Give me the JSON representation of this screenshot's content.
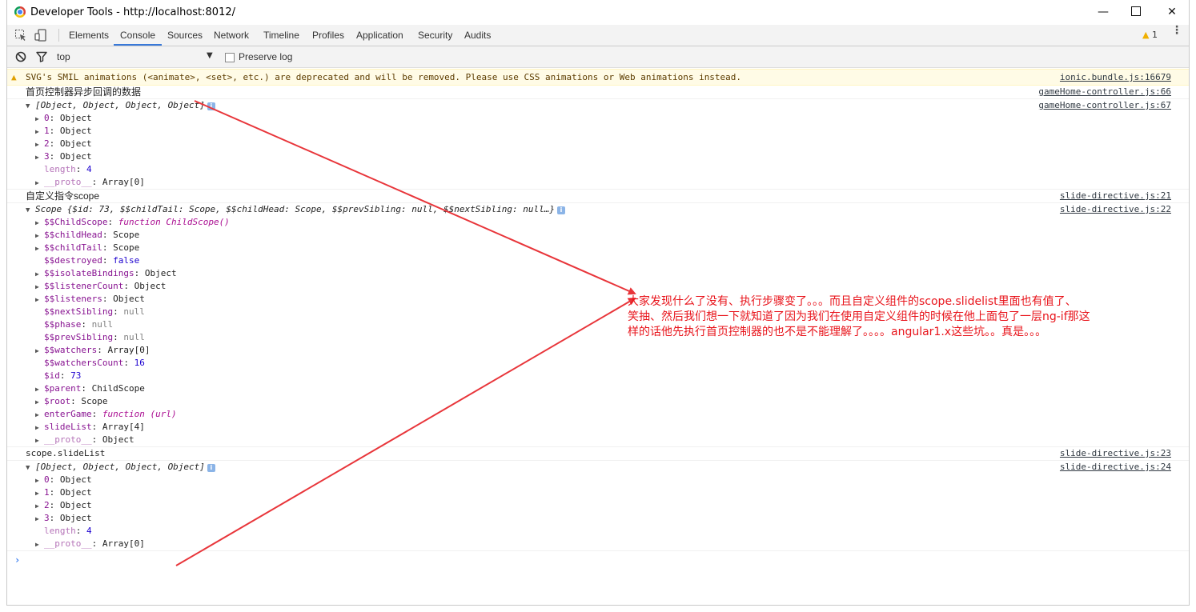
{
  "window": {
    "title": "Developer Tools - http://localhost:8012/",
    "minimize_glyph": "—",
    "close_glyph": "✕"
  },
  "tabs": [
    {
      "label": "Elements"
    },
    {
      "label": "Console",
      "active": true
    },
    {
      "label": "Sources"
    },
    {
      "label": "Network"
    },
    {
      "label": "Timeline"
    },
    {
      "label": "Profiles"
    },
    {
      "label": "Application"
    },
    {
      "label": "Security"
    },
    {
      "label": "Audits"
    }
  ],
  "warnings_count": "1",
  "filterbar": {
    "context": "top",
    "preserve_log_label": "Preserve log",
    "preserve_log_checked": false
  },
  "console": {
    "warning": {
      "text": "SVG's SMIL animations (<animate>, <set>, etc.) are deprecated and will be removed. Please use CSS animations or Web animations instead.",
      "source": "ionic.bundle.js:16679"
    },
    "log1": {
      "text": "首页控制器异步回调的数据",
      "source": "gameHome-controller.js:66"
    },
    "array1": {
      "summary": "[Object, Object, Object, Object]",
      "source": "gameHome-controller.js:67",
      "items": [
        {
          "key": "0",
          "value": "Object"
        },
        {
          "key": "1",
          "value": "Object"
        },
        {
          "key": "2",
          "value": "Object"
        },
        {
          "key": "3",
          "value": "Object"
        }
      ],
      "length_key": "length",
      "length_value": "4",
      "proto_key": "__proto__",
      "proto_value": "Array[0]"
    },
    "log2": {
      "text": "自定义指令scope",
      "source": "slide-directive.js:21"
    },
    "scope": {
      "summary_prefix": "Scope ",
      "summary": "{$id: 73, $$childTail: Scope, $$childHead: Scope, $$prevSibling: null, $$nextSibling: null…}",
      "source": "slide-directive.js:22",
      "props": [
        {
          "key": "$$ChildScope",
          "value": "function ChildScope()",
          "expandable": true,
          "kind": "fn"
        },
        {
          "key": "$$childHead",
          "value": "Scope",
          "expandable": true,
          "kind": "obj"
        },
        {
          "key": "$$childTail",
          "value": "Scope",
          "expandable": true,
          "kind": "obj"
        },
        {
          "key": "$$destroyed",
          "value": "false",
          "expandable": false,
          "kind": "bool"
        },
        {
          "key": "$$isolateBindings",
          "value": "Object",
          "expandable": true,
          "kind": "obj"
        },
        {
          "key": "$$listenerCount",
          "value": "Object",
          "expandable": true,
          "kind": "obj"
        },
        {
          "key": "$$listeners",
          "value": "Object",
          "expandable": true,
          "kind": "obj"
        },
        {
          "key": "$$nextSibling",
          "value": "null",
          "expandable": false,
          "kind": "null"
        },
        {
          "key": "$$phase",
          "value": "null",
          "expandable": false,
          "kind": "null"
        },
        {
          "key": "$$prevSibling",
          "value": "null",
          "expandable": false,
          "kind": "null"
        },
        {
          "key": "$$watchers",
          "value": "Array[0]",
          "expandable": true,
          "kind": "obj"
        },
        {
          "key": "$$watchersCount",
          "value": "16",
          "expandable": false,
          "kind": "num"
        },
        {
          "key": "$id",
          "value": "73",
          "expandable": false,
          "kind": "num"
        },
        {
          "key": "$parent",
          "value": "ChildScope",
          "expandable": true,
          "kind": "obj"
        },
        {
          "key": "$root",
          "value": "Scope",
          "expandable": true,
          "kind": "obj"
        },
        {
          "key": "enterGame",
          "value": "function (url)",
          "expandable": true,
          "kind": "fn"
        },
        {
          "key": "slideList",
          "value": "Array[4]",
          "expandable": true,
          "kind": "obj"
        },
        {
          "key": "__proto__",
          "value": "Object",
          "expandable": true,
          "kind": "proto"
        }
      ]
    },
    "log3": {
      "text": "scope.slideList",
      "source": "slide-directive.js:23"
    },
    "array2": {
      "summary": "[Object, Object, Object, Object]",
      "source": "slide-directive.js:24",
      "items": [
        {
          "key": "0",
          "value": "Object"
        },
        {
          "key": "1",
          "value": "Object"
        },
        {
          "key": "2",
          "value": "Object"
        },
        {
          "key": "3",
          "value": "Object"
        }
      ],
      "length_key": "length",
      "length_value": "4",
      "proto_key": "__proto__",
      "proto_value": "Array[0]"
    },
    "prompt_glyph": "›"
  },
  "annotation": {
    "line1": "大家发现什么了没有、执行步骤变了。。。而且自定义组件的scope.slidelist里面也有值了、",
    "line2": "笑抽、然后我们想一下就知道了因为我们在使用自定义组件的时候在他上面包了一层ng-if那这",
    "line3": "样的话他先执行首页控制器的也不是不能理解了。。。。angular1.x这些坑。。真是。。。",
    "color": "#e8141b"
  },
  "colors": {
    "accent": "#3879d9",
    "warning_bg": "#fffbe6",
    "arrow": "#e8353a"
  }
}
